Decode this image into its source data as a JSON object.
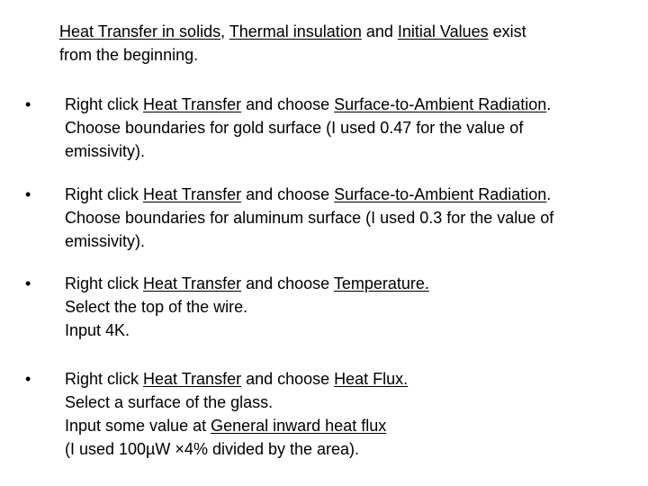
{
  "intro": {
    "segments": [
      {
        "text": "Heat Transfer in solids",
        "u": true
      },
      {
        "text": ", ",
        "u": false
      },
      {
        "text": "Thermal insulation",
        "u": true
      },
      {
        "text": " and ",
        "u": false
      },
      {
        "text": "Initial Values",
        "u": true
      },
      {
        "text": " exist",
        "u": false
      }
    ],
    "line2": "from the beginning."
  },
  "bullet_symbol": "•",
  "bullets": [
    {
      "lines": [
        [
          {
            "text": "Right click ",
            "u": false
          },
          {
            "text": "Heat Transfer",
            "u": true
          },
          {
            "text": " and choose ",
            "u": false
          },
          {
            "text": "Surface-to-Ambient Radiation",
            "u": true
          },
          {
            "text": ".",
            "u": false
          }
        ],
        [
          {
            "text": "Choose boundaries for gold surface (I used 0.47 for the value of",
            "u": false
          }
        ],
        [
          {
            "text": "emissivity).",
            "u": false
          }
        ]
      ]
    },
    {
      "lines": [
        [
          {
            "text": "Right click ",
            "u": false
          },
          {
            "text": "Heat Transfer",
            "u": true
          },
          {
            "text": " and choose ",
            "u": false
          },
          {
            "text": "Surface-to-Ambient Radiation",
            "u": true
          },
          {
            "text": ".",
            "u": false
          }
        ],
        [
          {
            "text": "Choose boundaries for aluminum surface (I used 0.3 for the value of",
            "u": false
          }
        ],
        [
          {
            "text": "emissivity).",
            "u": false
          }
        ]
      ]
    },
    {
      "lines": [
        [
          {
            "text": "Right click ",
            "u": false
          },
          {
            "text": "Heat Transfer",
            "u": true
          },
          {
            "text": " and choose ",
            "u": false
          },
          {
            "text": "Temperature.",
            "u": true
          }
        ],
        [
          {
            "text": "Select the top of the wire.",
            "u": false
          }
        ],
        [
          {
            "text": "Input 4K.",
            "u": false
          }
        ]
      ]
    },
    {
      "lines": [
        [
          {
            "text": "Right click ",
            "u": false
          },
          {
            "text": "Heat Transfer",
            "u": true
          },
          {
            "text": " and choose ",
            "u": false
          },
          {
            "text": "Heat Flux.",
            "u": true
          }
        ],
        [
          {
            "text": "Select a surface of the glass.",
            "u": false
          }
        ],
        [
          {
            "text": "Input some value at ",
            "u": false
          },
          {
            "text": "General inward heat flux",
            "u": true
          }
        ],
        [
          {
            "text": "(I used 100µW ×4% divided by the area).",
            "u": false
          }
        ]
      ]
    }
  ]
}
